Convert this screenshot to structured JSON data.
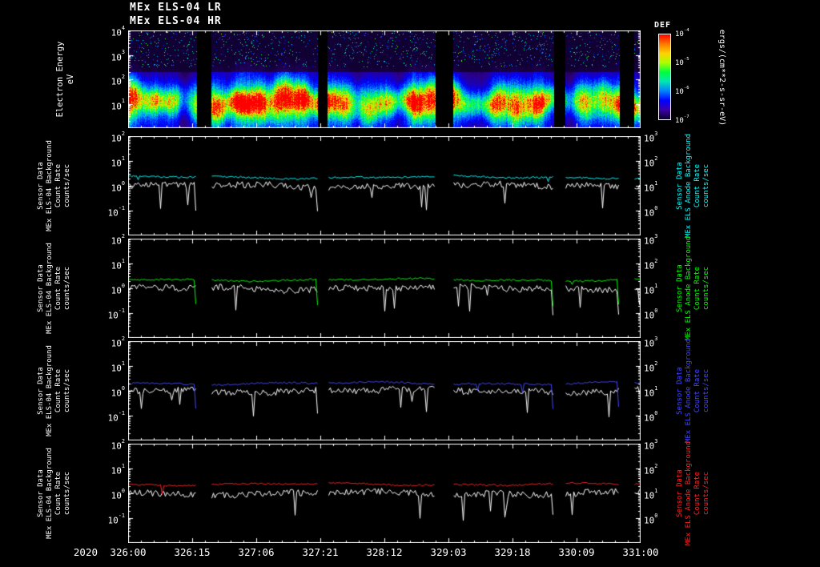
{
  "titles": {
    "line1": "MEx ELS-04 LR",
    "line2": "MEx ELS-04 HR"
  },
  "colorbar": {
    "label": "DEF",
    "unit": "ergs/(cm**2-s-sr-eV)",
    "tick_exponents": [
      -4,
      -5,
      -6,
      -7
    ],
    "gradient_top_to_bottom": [
      "#ff0000",
      "#ff7800",
      "#ffd200",
      "#aaff00",
      "#00ff3c",
      "#00e6b4",
      "#0082ff",
      "#0000ff",
      "#3c00aa",
      "#0a0028"
    ]
  },
  "time_axis": {
    "year_label": "2020",
    "tick_labels": [
      "326:00",
      "326:15",
      "327:06",
      "327:21",
      "328:12",
      "329:03",
      "329:18",
      "330:09",
      "331:00"
    ]
  },
  "spectrogram": {
    "ylabel_line1": "Electron Energy",
    "ylabel_line2": "eV",
    "y_tick_exponents": [
      4,
      3,
      2,
      1
    ]
  },
  "left_axis_label_lines": [
    "Sensor Data",
    "MEx ELS-04 Background",
    "Count Rate",
    "counts/sec"
  ],
  "data_gaps_frac": [
    [
      0.134,
      0.161
    ],
    [
      0.369,
      0.389
    ],
    [
      0.6,
      0.633
    ],
    [
      0.831,
      0.853
    ],
    [
      0.958,
      0.986
    ]
  ],
  "chart_data": [
    {
      "type": "heatmap",
      "title": "MEx ELS-04 LR / MEx ELS-04 HR electron energy-time spectrogram",
      "xlabel": "time (2020, day:hour)",
      "x_ticks": [
        "326:00",
        "326:15",
        "327:06",
        "327:21",
        "328:12",
        "329:03",
        "329:18",
        "330:09",
        "331:00"
      ],
      "ylabel": "Electron Energy (eV)",
      "y_range_exponents": [
        0,
        4
      ],
      "y_tick_exponents": [
        4,
        3,
        2,
        1
      ],
      "value_label": "DEF",
      "value_unit": "ergs/(cm**2-s-sr-eV)",
      "value_range_exponents": [
        -7,
        -4
      ],
      "data_gaps_frac": [
        [
          0.134,
          0.161
        ],
        [
          0.369,
          0.389
        ],
        [
          0.6,
          0.633
        ],
        [
          0.831,
          0.853
        ],
        [
          0.958,
          0.986
        ]
      ],
      "peak_band_energy_ev": 10,
      "description": "Broad flux maximum near 10 eV along the whole interval; brightest (red, ~1e-4) episode near day 327:06-327:21; dark low-flux background above ~300 eV with speckle noise; black vertical bars are data gaps."
    },
    {
      "type": "line",
      "name": "count-rate-panel-1",
      "accent_color": "#00ffff",
      "left_axis_tick_exponents": [
        2,
        1,
        0,
        -1
      ],
      "right_axis_tick_exponents": [
        3,
        2,
        1,
        0
      ],
      "y_range_exponents": [
        -2,
        2
      ],
      "right_label_lines": [
        "Sensor Data",
        "MEx ELS Anode Background",
        "Count Rate",
        "counts/sec"
      ],
      "series": [
        {
          "name": "MEx ELS-04 Background Count Rate",
          "color": "#ffffff",
          "baseline_counts_per_sec": 1.0,
          "noise_dex": 0.14
        },
        {
          "name": "MEx ELS Anode Background Count Rate",
          "color": "#00ffff",
          "baseline_counts_per_sec": 2.2,
          "noise_dex": 0.05
        }
      ]
    },
    {
      "type": "line",
      "name": "count-rate-panel-2",
      "accent_color": "#00ff00",
      "left_axis_tick_exponents": [
        2,
        1,
        0,
        -1
      ],
      "right_axis_tick_exponents": [
        3,
        2,
        1,
        0
      ],
      "y_range_exponents": [
        -2,
        2
      ],
      "right_label_lines": [
        "Sensor Data",
        "MEx ELS Anode Background",
        "Count Rate",
        "counts/sec"
      ],
      "series": [
        {
          "name": "MEx ELS-04 Background Count Rate",
          "color": "#ffffff",
          "baseline_counts_per_sec": 1.0,
          "noise_dex": 0.14
        },
        {
          "name": "MEx ELS Anode Background Count Rate",
          "color": "#00ff00",
          "baseline_counts_per_sec": 2.2,
          "noise_dex": 0.05
        }
      ]
    },
    {
      "type": "line",
      "name": "count-rate-panel-3",
      "accent_color": "#4444ff",
      "left_axis_tick_exponents": [
        2,
        1,
        0,
        -1
      ],
      "right_axis_tick_exponents": [
        3,
        2,
        1,
        0
      ],
      "y_range_exponents": [
        -2,
        2
      ],
      "right_label_lines": [
        "Sensor Data",
        "MEx ELS Anode Background",
        "Count Rate",
        "counts/sec"
      ],
      "series": [
        {
          "name": "MEx ELS-04 Background Count Rate",
          "color": "#ffffff",
          "baseline_counts_per_sec": 1.0,
          "noise_dex": 0.14
        },
        {
          "name": "MEx ELS Anode Background Count Rate",
          "color": "#4444ff",
          "baseline_counts_per_sec": 2.0,
          "noise_dex": 0.05
        }
      ]
    },
    {
      "type": "line",
      "name": "count-rate-panel-4",
      "accent_color": "#ff2222",
      "left_axis_tick_exponents": [
        2,
        1,
        0,
        -1
      ],
      "right_axis_tick_exponents": [
        3,
        2,
        1,
        0
      ],
      "y_range_exponents": [
        -2,
        2
      ],
      "right_label_lines": [
        "Sensor Data",
        "MEx ELS Anode Background",
        "Count Rate",
        "counts/sec"
      ],
      "series": [
        {
          "name": "MEx ELS-04 Background Count Rate",
          "color": "#ffffff",
          "baseline_counts_per_sec": 1.0,
          "noise_dex": 0.14
        },
        {
          "name": "MEx ELS Anode Background Count Rate",
          "color": "#ff2222",
          "baseline_counts_per_sec": 2.3,
          "noise_dex": 0.05
        }
      ]
    }
  ]
}
